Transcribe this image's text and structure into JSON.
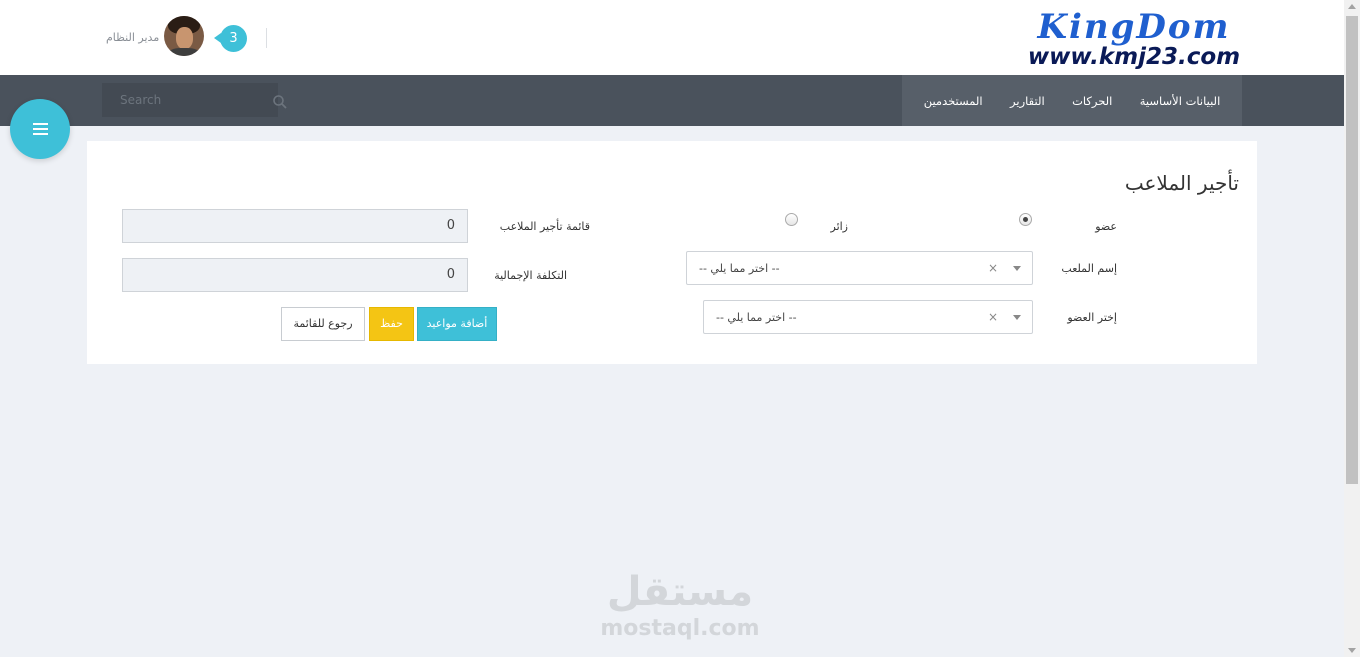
{
  "header": {
    "logo_main": "KingDom",
    "logo_url": "www.kmj23.com",
    "user_name": "مدير النظام",
    "notification_count": "3"
  },
  "nav": {
    "search_placeholder": "Search",
    "menu": [
      {
        "label": "البيانات الأساسية"
      },
      {
        "label": "الحركات"
      },
      {
        "label": "التقارير"
      },
      {
        "label": "المستخدمين"
      }
    ]
  },
  "form": {
    "title": "تأجير الملاعب",
    "radio_member_label": "عضو",
    "radio_visitor_label": "زائر",
    "radio_selected": "عضو",
    "field_name_label": "إسم الملعب",
    "field_name_value": "-- اختر مما يلي --",
    "member_label": "إختر العضو",
    "member_value": "-- اختر مما يلي --",
    "rental_list_label": "قائمة تأجير الملاعب",
    "rental_list_value": "0",
    "total_cost_label": "التكلفة الإجمالية",
    "total_cost_value": "0",
    "add_appointments_label": "أضافة مواعيد",
    "save_label": "حفظ",
    "back_label": "رجوع للقائمة"
  },
  "watermark": {
    "arabic": "مستقل",
    "english": "mostaql.com"
  },
  "colors": {
    "accent": "#3ec0d8",
    "navbar": "#4a525c",
    "save": "#f4c514"
  },
  "icons": {
    "fab": "hamburger-menu-icon",
    "search": "search-icon"
  }
}
